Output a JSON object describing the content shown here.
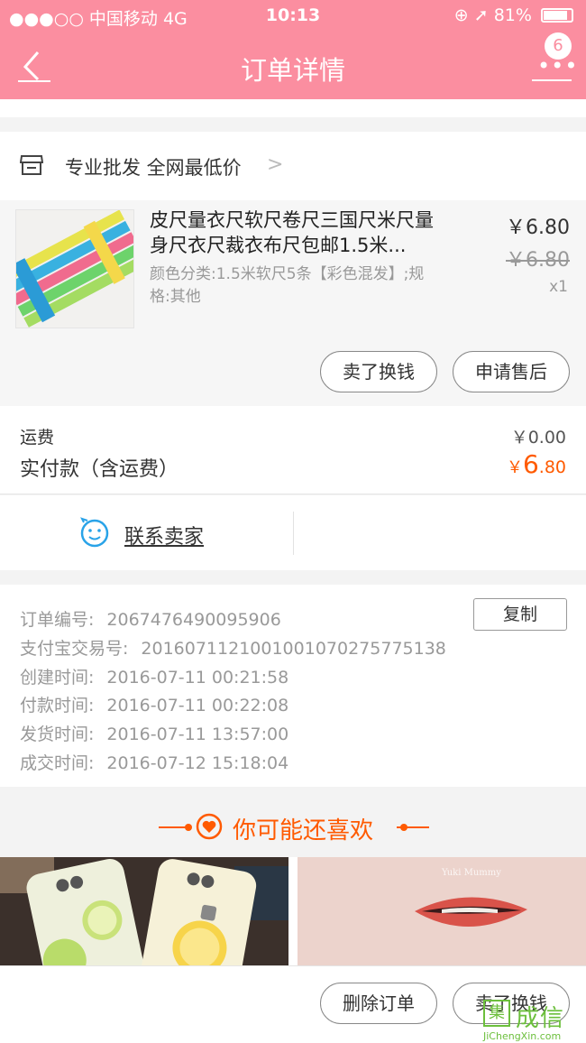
{
  "status_bar": {
    "carrier": "●●●○○ 中国移动  4G",
    "time": "10:13",
    "battery": "81%"
  },
  "navbar": {
    "title": "订单详情",
    "badge_count": "6"
  },
  "shop": {
    "name": "专业批发 全网最低价"
  },
  "item": {
    "name": "皮尺量衣尺软尺卷尺三国尺米尺量身尺衣尺裁衣布尺包邮1.5米...",
    "sku": "颜色分类:1.5米软尺5条【彩色混发】;规格:其他",
    "price": "￥6.80",
    "original_price": "￥6.80",
    "quantity": "x1",
    "sell_button": "卖了换钱",
    "aftersale_button": "申请售后"
  },
  "fees": {
    "shipping_label": "运费",
    "shipping_value": "￥0.00",
    "paid_label": "实付款（含运费）",
    "paid_currency": "￥",
    "paid_int": "6",
    "paid_dec": ".80"
  },
  "contact": {
    "label": "联系卖家"
  },
  "order_info": {
    "copy_button": "复制",
    "rows": [
      {
        "label": "订单编号:",
        "value": "2067476490095906"
      },
      {
        "label": "支付宝交易号:",
        "value": "2016071121001001070275775138"
      },
      {
        "label": "创建时间:",
        "value": "2016-07-11 00:21:58"
      },
      {
        "label": "付款时间:",
        "value": "2016-07-11 00:22:08"
      },
      {
        "label": "发货时间:",
        "value": "2016-07-11 13:57:00"
      },
      {
        "label": "成交时间:",
        "value": "2016-07-12 15:18:04"
      }
    ]
  },
  "recommend": {
    "title": "你可能还喜欢",
    "image2_text": "Yuki Mummy"
  },
  "bottom_bar": {
    "delete_button": "删除订单",
    "sell_button": "卖了换钱"
  },
  "watermark": {
    "box": "集",
    "text": "成信",
    "url": "JiChengXin.com"
  },
  "colors": {
    "header_pink": "#fb8ea0",
    "accent_orange": "#ff5a00"
  }
}
